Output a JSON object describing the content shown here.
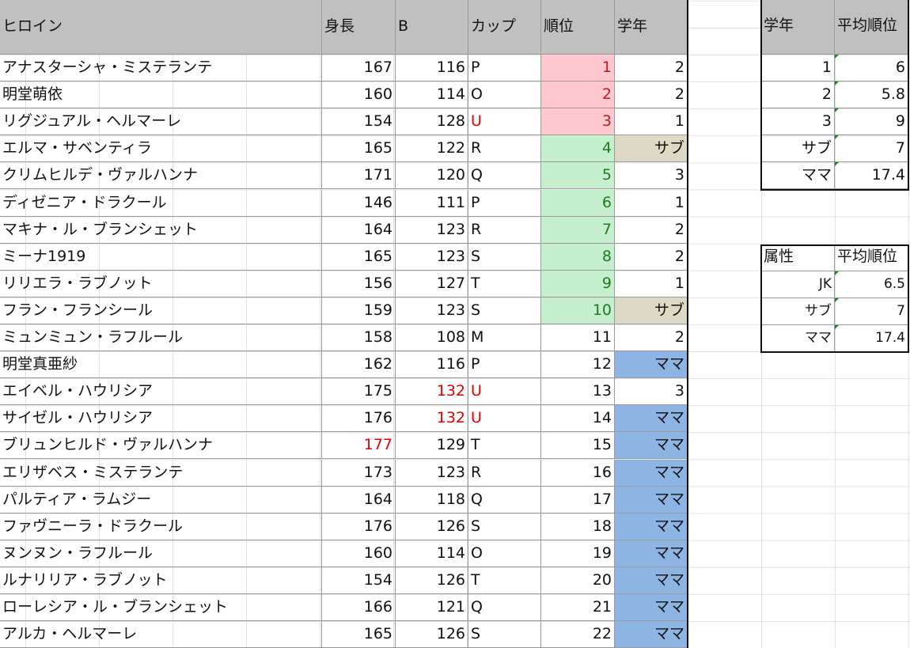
{
  "headers": [
    "ヒロイン",
    "身長",
    "B",
    "カップ",
    "順位",
    "学年"
  ],
  "rows": [
    [
      "アナスターシャ・ミステランテ",
      "167",
      "116",
      "P",
      "1",
      "2"
    ],
    [
      "明堂萌依",
      "160",
      "114",
      "O",
      "2",
      "2"
    ],
    [
      "リグジュアル・ヘルマーレ",
      "154",
      "128",
      "U",
      "3",
      "1"
    ],
    [
      "エルマ・サベンティラ",
      "165",
      "122",
      "R",
      "4",
      "サブ"
    ],
    [
      "クリムヒルデ・ヴァルハンナ",
      "171",
      "120",
      "Q",
      "5",
      "3"
    ],
    [
      "ディゼニア・ドラクール",
      "146",
      "111",
      "P",
      "6",
      "1"
    ],
    [
      "マキナ・ル・ブランシェット",
      "164",
      "123",
      "R",
      "7",
      "2"
    ],
    [
      "ミーナ1919",
      "165",
      "123",
      "S",
      "8",
      "2"
    ],
    [
      "リリエラ・ラブノット",
      "156",
      "127",
      "T",
      "9",
      "1"
    ],
    [
      "フラン・フランシール",
      "159",
      "123",
      "S",
      "10",
      "サブ"
    ],
    [
      "ミュンミュン・ラフルール",
      "158",
      "108",
      "M",
      "11",
      "2"
    ],
    [
      "明堂真亜紗",
      "162",
      "116",
      "P",
      "12",
      "ママ"
    ],
    [
      "エイベル・ハウリシア",
      "175",
      "132",
      "U",
      "13",
      "3"
    ],
    [
      "サイゼル・ハウリシア",
      "176",
      "132",
      "U",
      "14",
      "ママ"
    ],
    [
      "ブリュンヒルド・ヴァルハンナ",
      "177",
      "129",
      "T",
      "15",
      "ママ"
    ],
    [
      "エリザベス・ミステランテ",
      "173",
      "123",
      "R",
      "16",
      "ママ"
    ],
    [
      "パルティア・ラムジー",
      "164",
      "118",
      "Q",
      "17",
      "ママ"
    ],
    [
      "ファヴニーラ・ドラクール",
      "176",
      "126",
      "S",
      "18",
      "ママ"
    ],
    [
      "ヌンヌン・ラフルール",
      "160",
      "114",
      "O",
      "19",
      "ママ"
    ],
    [
      "ルナリリア・ラブノット",
      "154",
      "126",
      "T",
      "20",
      "ママ"
    ],
    [
      "ローレシア・ル・ブランシェット",
      "166",
      "121",
      "Q",
      "21",
      "ママ"
    ],
    [
      "アルカ・ヘルマーレ",
      "165",
      "126",
      "S",
      "22",
      "ママ"
    ]
  ],
  "grade_table": {
    "headers": [
      "学年",
      "平均順位"
    ],
    "rows": [
      [
        "1",
        "6"
      ],
      [
        "2",
        "5.8"
      ],
      [
        "3",
        "9"
      ],
      [
        "サブ",
        "7"
      ],
      [
        "ママ",
        "17.4"
      ]
    ]
  },
  "attr_table": {
    "headers": [
      "属性",
      "平均順位"
    ],
    "rows": [
      [
        "JK",
        "6.5"
      ],
      [
        "サブ",
        "7"
      ],
      [
        "ママ",
        "17.4"
      ]
    ]
  },
  "colors": {
    "top3": "#ffc7ce",
    "top10": "#c6efce",
    "sub": "#ddd9c4",
    "mama": "#8db4e2",
    "highlight_text": "#e00000"
  }
}
